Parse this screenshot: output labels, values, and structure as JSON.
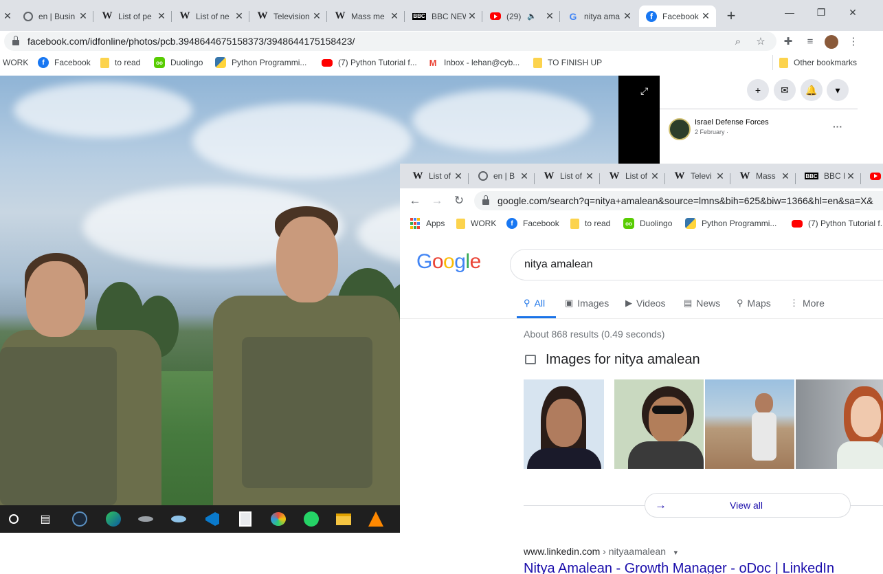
{
  "back_browser": {
    "tabs": [
      {
        "title": "",
        "icon": "close-icon"
      },
      {
        "title": "en | Busin",
        "icon": "globe-icon"
      },
      {
        "title": "List of pe",
        "icon": "wikipedia-icon"
      },
      {
        "title": "List of ne",
        "icon": "wikipedia-icon"
      },
      {
        "title": "Television",
        "icon": "wikipedia-icon"
      },
      {
        "title": "Mass me",
        "icon": "wikipedia-icon"
      },
      {
        "title": "BBC NEW",
        "icon": "bbc-icon"
      },
      {
        "title": "(29)",
        "icon": "youtube-icon"
      },
      {
        "title": "nitya ama",
        "icon": "google-icon"
      },
      {
        "title": "Facebook",
        "icon": "facebook-icon",
        "active": true
      }
    ],
    "url": "facebook.com/idfonline/photos/pcb.3948644675158373/3948644175158423/",
    "bookmarks": [
      {
        "label": "WORK",
        "icon": "none"
      },
      {
        "label": "Facebook",
        "icon": "facebook-icon"
      },
      {
        "label": "to read",
        "icon": "folder-icon"
      },
      {
        "label": "Duolingo",
        "icon": "duolingo-icon"
      },
      {
        "label": "Python Programmi...",
        "icon": "python-icon"
      },
      {
        "label": "(7) Python Tutorial f...",
        "icon": "youtube-icon"
      },
      {
        "label": "Inbox - lehan@cyb...",
        "icon": "gmail-icon"
      },
      {
        "label": "TO FINISH UP",
        "icon": "folder-icon"
      }
    ],
    "other_bookmarks": "Other bookmarks",
    "facebook": {
      "page_name": "Israel Defense Forces",
      "post_date": "2 February · ",
      "more": "···"
    }
  },
  "front_browser": {
    "tabs": [
      {
        "title": "List of",
        "icon": "wikipedia-icon"
      },
      {
        "title": "en | B",
        "icon": "globe-icon"
      },
      {
        "title": "List of",
        "icon": "wikipedia-icon"
      },
      {
        "title": "List of",
        "icon": "wikipedia-icon"
      },
      {
        "title": "Televi",
        "icon": "wikipedia-icon"
      },
      {
        "title": "Mass",
        "icon": "wikipedia-icon"
      },
      {
        "title": "BBC N",
        "icon": "bbc-icon"
      },
      {
        "title": "",
        "icon": "youtube-icon"
      }
    ],
    "url": "google.com/search?q=nitya+amalean&source=lmns&bih=625&biw=1366&hl=en&sa=X&",
    "bookmarks": [
      {
        "label": "Apps",
        "icon": "apps-icon"
      },
      {
        "label": "WORK",
        "icon": "folder-icon"
      },
      {
        "label": "Facebook",
        "icon": "facebook-icon"
      },
      {
        "label": "to read",
        "icon": "folder-icon"
      },
      {
        "label": "Duolingo",
        "icon": "duolingo-icon"
      },
      {
        "label": "Python Programmi...",
        "icon": "python-icon"
      },
      {
        "label": "(7) Python Tutorial f...",
        "icon": "youtube-icon"
      }
    ],
    "google": {
      "logo": "Google",
      "query": "nitya amalean",
      "tabs": [
        {
          "label": "All",
          "icon": "search-icon",
          "active": true
        },
        {
          "label": "Images",
          "icon": "image-icon"
        },
        {
          "label": "Videos",
          "icon": "play-icon"
        },
        {
          "label": "News",
          "icon": "news-icon"
        },
        {
          "label": "Maps",
          "icon": "map-pin-icon"
        },
        {
          "label": "More",
          "icon": "more-vert-icon"
        }
      ],
      "stats": "About 868 results (0.49 seconds)",
      "images_title": "Images for nitya amalean",
      "view_all": "View all",
      "result": {
        "domain": "www.linkedin.com",
        "path": " › nityaamalean",
        "title": "Nitya Amalean - Growth Manager - oDoc | LinkedIn"
      }
    }
  },
  "colors": {
    "google_blue": "#4285f4",
    "google_red": "#ea4335",
    "google_yellow": "#fbbc05",
    "google_green": "#34a853",
    "link": "#1a0dab",
    "active_tab": "#1a73e8"
  }
}
